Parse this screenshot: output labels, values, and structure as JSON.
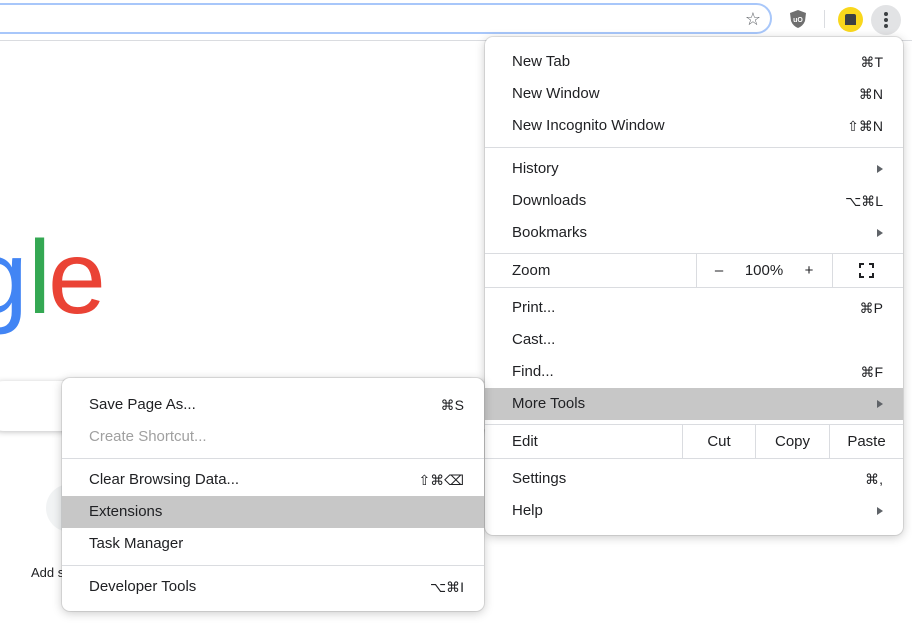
{
  "toolbar": {
    "star_glyph": "☆",
    "ublock_label": "uO"
  },
  "page": {
    "logo_letters": [
      {
        "ch": "g",
        "color": "#4285F4"
      },
      {
        "ch": "l",
        "color": "#34A853"
      },
      {
        "ch": "e",
        "color": "#EA4335"
      }
    ],
    "add_shortcut_label": "Add s"
  },
  "main_menu": {
    "new_tab": {
      "label": "New Tab",
      "shortcut": "⌘T"
    },
    "new_window": {
      "label": "New Window",
      "shortcut": "⌘N"
    },
    "new_incognito": {
      "label": "New Incognito Window",
      "shortcut": "⇧⌘N"
    },
    "history": {
      "label": "History"
    },
    "downloads": {
      "label": "Downloads",
      "shortcut": "⌥⌘L"
    },
    "bookmarks": {
      "label": "Bookmarks"
    },
    "zoom": {
      "label": "Zoom",
      "minus": "–",
      "value": "100%",
      "plus": "+"
    },
    "print": {
      "label": "Print...",
      "shortcut": "⌘P"
    },
    "cast": {
      "label": "Cast..."
    },
    "find": {
      "label": "Find...",
      "shortcut": "⌘F"
    },
    "more_tools": {
      "label": "More Tools"
    },
    "edit": {
      "label": "Edit",
      "cut": "Cut",
      "copy": "Copy",
      "paste": "Paste"
    },
    "settings": {
      "label": "Settings",
      "shortcut": "⌘,"
    },
    "help": {
      "label": "Help"
    }
  },
  "sub_menu": {
    "save_page": {
      "label": "Save Page As...",
      "shortcut": "⌘S"
    },
    "create_shortcut": {
      "label": "Create Shortcut..."
    },
    "clear_browsing": {
      "label": "Clear Browsing Data...",
      "shortcut": "⇧⌘⌫"
    },
    "extensions": {
      "label": "Extensions"
    },
    "task_manager": {
      "label": "Task Manager"
    },
    "developer_tools": {
      "label": "Developer Tools",
      "shortcut": "⌥⌘I"
    }
  },
  "colors": {
    "highlight": "#c7c7c7",
    "profile": "#f9d71c",
    "omnibox_focus": "#a8c7fa"
  }
}
